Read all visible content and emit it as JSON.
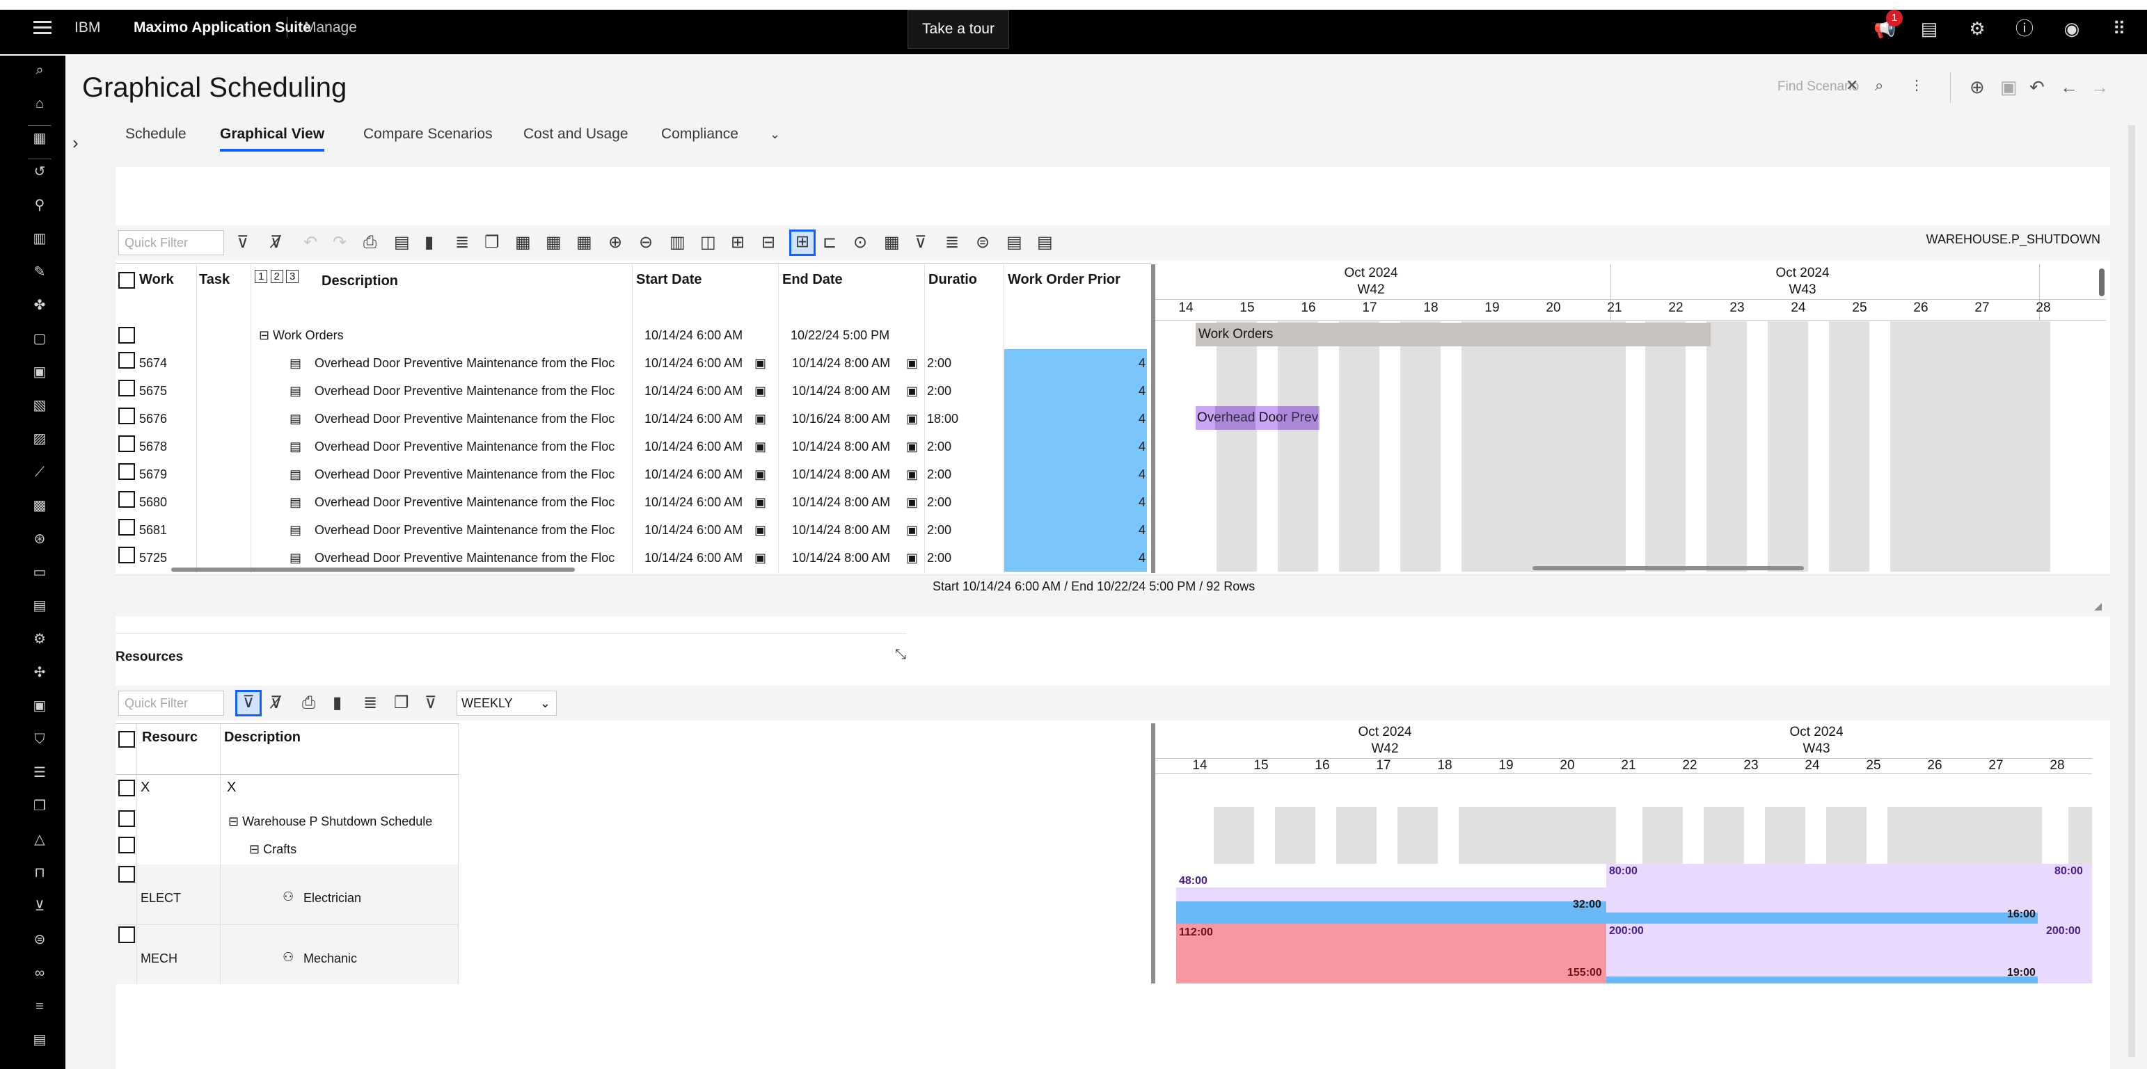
{
  "header": {
    "brand_prefix": "IBM",
    "brand_name": "Maximo Application Suite",
    "app": "Manage",
    "tour_button": "Take a tour",
    "notification_count": "1"
  },
  "page": {
    "title": "Graphical Scheduling",
    "find_scenario_placeholder": "Find Scenario",
    "tabs": [
      "Schedule",
      "Graphical View",
      "Compare Scenarios",
      "Cost and Usage",
      "Compliance"
    ],
    "active_tab": "Graphical View"
  },
  "gantt": {
    "quick_filter_placeholder": "Quick Filter",
    "scenario_name": "WAREHOUSE.P_SHUTDOWN",
    "columns": {
      "work": "Work",
      "task": "Task",
      "levels": [
        "1",
        "2",
        "3"
      ],
      "description": "Description",
      "start": "Start Date",
      "end": "End Date",
      "duration": "Duratio",
      "priority": "Work Order Prior"
    },
    "group_row": {
      "description": "Work Orders",
      "start": "10/14/24 6:00 AM",
      "end": "10/22/24 5:00 PM"
    },
    "rows": [
      {
        "wo": "5674",
        "description": "Overhead Door Preventive Maintenance from the Floc",
        "start": "10/14/24 6:00 AM",
        "end": "10/14/24 8:00 AM",
        "duration": "2:00",
        "priority": "4"
      },
      {
        "wo": "5675",
        "description": "Overhead Door Preventive Maintenance from the Floc",
        "start": "10/14/24 6:00 AM",
        "end": "10/14/24 8:00 AM",
        "duration": "2:00",
        "priority": "4"
      },
      {
        "wo": "5676",
        "description": "Overhead Door Preventive Maintenance from the Floc",
        "start": "10/14/24 6:00 AM",
        "end": "10/16/24 8:00 AM",
        "duration": "18:00",
        "priority": "4"
      },
      {
        "wo": "5678",
        "description": "Overhead Door Preventive Maintenance from the Floc",
        "start": "10/14/24 6:00 AM",
        "end": "10/14/24 8:00 AM",
        "duration": "2:00",
        "priority": "4"
      },
      {
        "wo": "5679",
        "description": "Overhead Door Preventive Maintenance from the Floc",
        "start": "10/14/24 6:00 AM",
        "end": "10/14/24 8:00 AM",
        "duration": "2:00",
        "priority": "4"
      },
      {
        "wo": "5680",
        "description": "Overhead Door Preventive Maintenance from the Floc",
        "start": "10/14/24 6:00 AM",
        "end": "10/14/24 8:00 AM",
        "duration": "2:00",
        "priority": "4"
      },
      {
        "wo": "5681",
        "description": "Overhead Door Preventive Maintenance from the Floc",
        "start": "10/14/24 6:00 AM",
        "end": "10/14/24 8:00 AM",
        "duration": "2:00",
        "priority": "4"
      },
      {
        "wo": "5725",
        "description": "Overhead Door Preventive Maintenance from the Floc",
        "start": "10/14/24 6:00 AM",
        "end": "10/14/24 8:00 AM",
        "duration": "2:00",
        "priority": "4"
      }
    ],
    "timeline": {
      "months": [
        "Oct 2024",
        "Oct 2024"
      ],
      "weeks": [
        "W42",
        "W43"
      ],
      "days": [
        "14",
        "15",
        "16",
        "17",
        "18",
        "19",
        "20",
        "21",
        "22",
        "23",
        "24",
        "25",
        "26",
        "27",
        "28"
      ]
    },
    "bar_group_label": "Work Orders",
    "bar_task_label": "Overhead Door Prev",
    "status": "Start 10/14/24 6:00 AM / End 10/22/24 5:00 PM / 92 Rows"
  },
  "resources": {
    "title": "Resources",
    "quick_filter_placeholder": "Quick Filter",
    "period": "WEEKLY",
    "columns": {
      "resource": "Resourc",
      "description": "Description"
    },
    "filter_row": [
      "X",
      "X"
    ],
    "schedule_label": "Warehouse P Shutdown Schedule",
    "crafts_label": "Crafts",
    "rows": [
      {
        "code": "ELECT",
        "description": "Electrician",
        "w42_capacity": "48:00",
        "w42_used": "32:00",
        "w43_capacity": "80:00",
        "w43_used": "16:00",
        "w44_capacity": "80:00"
      },
      {
        "code": "MECH",
        "description": "Mechanic",
        "w42_capacity": "112:00",
        "w42_used": "155:00",
        "w43_capacity": "200:00",
        "w43_used": "19:00",
        "w44_capacity": "200:00"
      }
    ]
  }
}
